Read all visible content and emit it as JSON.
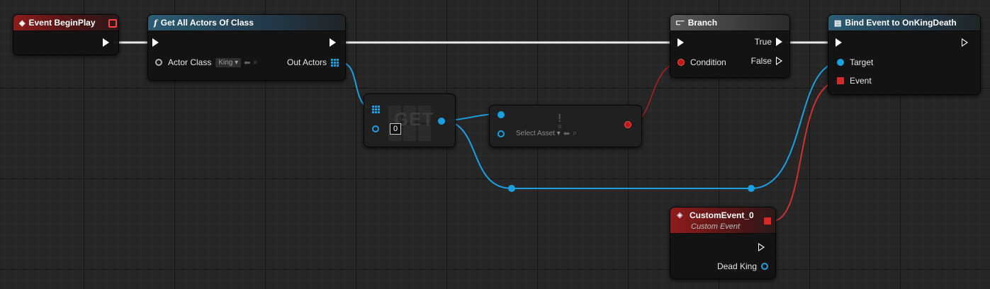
{
  "nodes": {
    "begin_play": {
      "title": "Event BeginPlay"
    },
    "get_all_actors": {
      "title": "Get All Actors Of Class",
      "actor_class_label": "Actor Class",
      "actor_class_value": "King",
      "out_actors_label": "Out Actors"
    },
    "get_array": {
      "title": "GET",
      "index_value": "0"
    },
    "is_valid": {
      "select_asset_label": "Select Asset"
    },
    "branch": {
      "title": "Branch",
      "condition_label": "Condition",
      "true_label": "True",
      "false_label": "False"
    },
    "bind_event": {
      "title": "Bind Event to OnKingDeath",
      "target_label": "Target",
      "event_label": "Event"
    },
    "custom_event": {
      "title": "CustomEvent_0",
      "subtitle": "Custom Event",
      "dead_king_label": "Dead King"
    }
  },
  "colors": {
    "exec_wire": "#ffffff",
    "object_wire": "#1aa0e0",
    "bool_wire": "#c02020",
    "delegate_wire": "#d03030"
  }
}
